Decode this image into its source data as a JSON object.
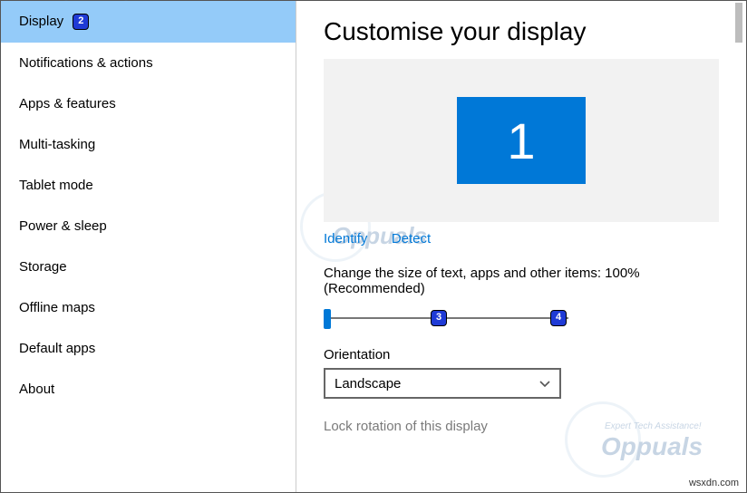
{
  "sidebar": {
    "items": [
      {
        "label": "Display",
        "selected": true,
        "badge": "2"
      },
      {
        "label": "Notifications & actions"
      },
      {
        "label": "Apps & features"
      },
      {
        "label": "Multi-tasking"
      },
      {
        "label": "Tablet mode"
      },
      {
        "label": "Power & sleep"
      },
      {
        "label": "Storage"
      },
      {
        "label": "Offline maps"
      },
      {
        "label": "Default apps"
      },
      {
        "label": "About"
      }
    ]
  },
  "main": {
    "title": "Customise your display",
    "monitor_number": "1",
    "identify": "Identify",
    "detect": "Detect",
    "scale_label": "Change the size of text, apps and other items: 100% (Recommended)",
    "slider_badge_mid": "3",
    "slider_badge_end": "4",
    "orientation_label": "Orientation",
    "orientation_value": "Landscape",
    "lock_label": "Lock rotation of this display"
  },
  "watermark": {
    "tag": "Expert Tech Assistance!",
    "brand": "Oppuals"
  },
  "credit": "wsxdn.com"
}
